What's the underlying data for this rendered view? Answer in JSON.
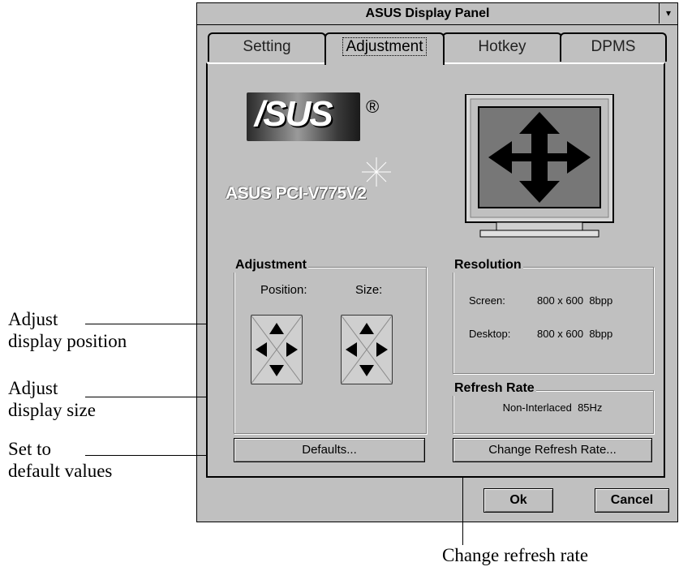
{
  "window": {
    "title": "ASUS Display Panel",
    "menu_glyph": "▾"
  },
  "tabs": [
    {
      "label": "Setting"
    },
    {
      "label": "Adjustment"
    },
    {
      "label": "Hotkey"
    },
    {
      "label": "DPMS"
    }
  ],
  "brand": {
    "logo_text": "/SUS",
    "registered": "®",
    "model": "ASUS PCI-V775V2"
  },
  "adjustment": {
    "label": "Adjustment",
    "position_label": "Position:",
    "size_label": "Size:"
  },
  "resolution": {
    "label": "Resolution",
    "screen_label": "Screen:",
    "screen_value": "800 x 600  8bpp",
    "desktop_label": "Desktop:",
    "desktop_value": "800 x 600  8bpp"
  },
  "refresh": {
    "label": "Refresh Rate",
    "value": "Non-Interlaced  85Hz"
  },
  "buttons": {
    "defaults": "Defaults...",
    "change_refresh": "Change Refresh Rate...",
    "ok": "Ok",
    "cancel": "Cancel"
  },
  "annotations": {
    "position": [
      "Adjust",
      "display position"
    ],
    "size": [
      "Adjust",
      "display size"
    ],
    "defaults": [
      "Set to",
      "default values"
    ],
    "refresh": "Change refresh rate"
  },
  "colors": {
    "dialog_bg": "#c0c0c0",
    "monitor_screen": "#777777",
    "arrow_fill": "#000000"
  }
}
